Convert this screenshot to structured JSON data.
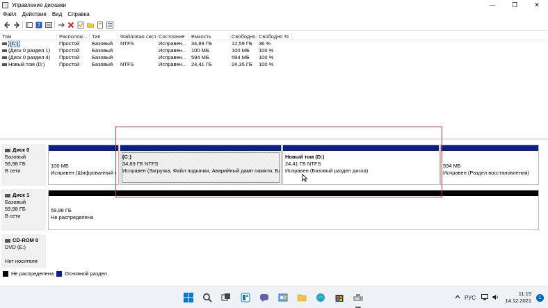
{
  "window": {
    "title": "Управление дисками",
    "minimize_glyph": "—",
    "maximize_glyph": "❐",
    "close_glyph": "✕"
  },
  "menu": [
    "Файл",
    "Действие",
    "Вид",
    "Справка"
  ],
  "toolbar": [
    "back-icon",
    "forward-icon",
    "console-tree-icon",
    "help-icon",
    "properties-icon",
    "map-drive-icon",
    "delete-icon",
    "check-icon",
    "folder-icon",
    "open-icon",
    "more-icon"
  ],
  "volumes": {
    "headers": [
      "Том",
      "Располож...",
      "Тип",
      "Файловая сист...",
      "Состояние",
      "Емкость",
      "Свободно...",
      "Свободно %"
    ],
    "rows": [
      [
        "(C:)",
        "Простой",
        "Базовый",
        "NTFS",
        "Исправен...",
        "34,89 ГБ",
        "12,59 ГБ",
        "36 %"
      ],
      [
        "(Диск 0 раздел 1)",
        "Простой",
        "Базовый",
        "",
        "Исправен...",
        "100 МБ",
        "100 МБ",
        "100 %"
      ],
      [
        "(Диск 0 раздел 4)",
        "Простой",
        "Базовый",
        "",
        "Исправен...",
        "594 МБ",
        "594 МБ",
        "100 %"
      ],
      [
        "Новый том (D:)",
        "Простой",
        "Базовый",
        "NTFS",
        "Исправен...",
        "24,41 ГБ",
        "24,35 ГБ",
        "100 %"
      ]
    ]
  },
  "disks": {
    "disk0": {
      "name": "Диск 0",
      "type": "Базовый",
      "size": "59,98 ГБ",
      "status": "В сети",
      "partitions": [
        {
          "line1": "",
          "line2": "100 МБ",
          "line3": "Исправен (Шифрованный (EFI) системный раздел)"
        },
        {
          "line1": "(C:)",
          "line2": "34,89 ГБ NTFS",
          "line3": "Исправен (Загрузка, Файл подкачки, Аварийный дамп памяти, Базовый раздел данных)"
        },
        {
          "line1": "Новый том  (D:)",
          "line2": "24,41 ГБ NTFS",
          "line3": "Исправен (Базовый раздел диска)"
        },
        {
          "line1": "",
          "line2": "594 МБ",
          "line3": "Исправен (Раздел восстановления)"
        }
      ]
    },
    "disk1": {
      "name": "Диск 1",
      "type": "Базовый",
      "size": "59,98 ГБ",
      "status": "В сети",
      "partitions": [
        {
          "line1": "59,98 ГБ",
          "line2": "Не распределена"
        }
      ]
    },
    "cdrom0": {
      "name": "CD-ROM 0",
      "type": "DVD (E:)",
      "status": "Нет носителя"
    }
  },
  "legend": {
    "unallocated": "Не распределена",
    "primary": "Основной раздел",
    "unallocated_color": "#000000",
    "primary_color": "#0a1f8a"
  },
  "taskbar": {
    "icons": [
      "windows-start-icon",
      "search-icon",
      "task-view-icon",
      "widgets-icon",
      "chat-icon",
      "control-panel-icon",
      "file-explorer-icon",
      "edge-icon",
      "store-icon",
      "disk-management-icon"
    ],
    "language": "РУС",
    "time": "11:15",
    "date": "14.12.2021",
    "notifications": "1"
  }
}
